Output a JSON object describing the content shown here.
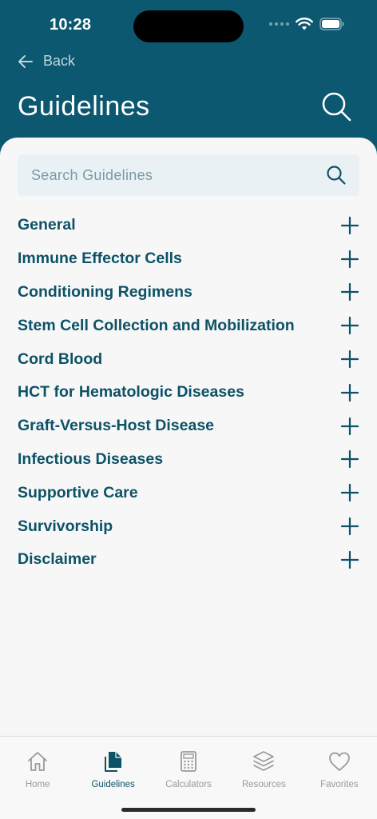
{
  "status_bar": {
    "time": "10:28"
  },
  "nav": {
    "back_label": "Back",
    "title": "Guidelines"
  },
  "search": {
    "placeholder": "Search Guidelines"
  },
  "guidelines": [
    {
      "label": "General"
    },
    {
      "label": "Immune Effector Cells"
    },
    {
      "label": "Conditioning Regimens"
    },
    {
      "label": "Stem Cell Collection and Mobilization"
    },
    {
      "label": "Cord Blood"
    },
    {
      "label": "HCT for Hematologic Diseases"
    },
    {
      "label": "Graft-Versus-Host Disease"
    },
    {
      "label": "Infectious Diseases"
    },
    {
      "label": "Supportive Care"
    },
    {
      "label": "Survivorship"
    },
    {
      "label": "Disclaimer"
    }
  ],
  "tab_bar": {
    "tabs": [
      {
        "label": "Home",
        "icon": "home-icon",
        "active": false
      },
      {
        "label": "Guidelines",
        "icon": "documents-icon",
        "active": true
      },
      {
        "label": "Calculators",
        "icon": "calculator-icon",
        "active": false
      },
      {
        "label": "Resources",
        "icon": "layers-icon",
        "active": false
      },
      {
        "label": "Favorites",
        "icon": "heart-icon",
        "active": false
      }
    ]
  },
  "colors": {
    "header_bg": "#0b5870",
    "accent": "#0d5266",
    "inactive": "#9a9a9a",
    "search_bg": "#eaf1f4"
  }
}
